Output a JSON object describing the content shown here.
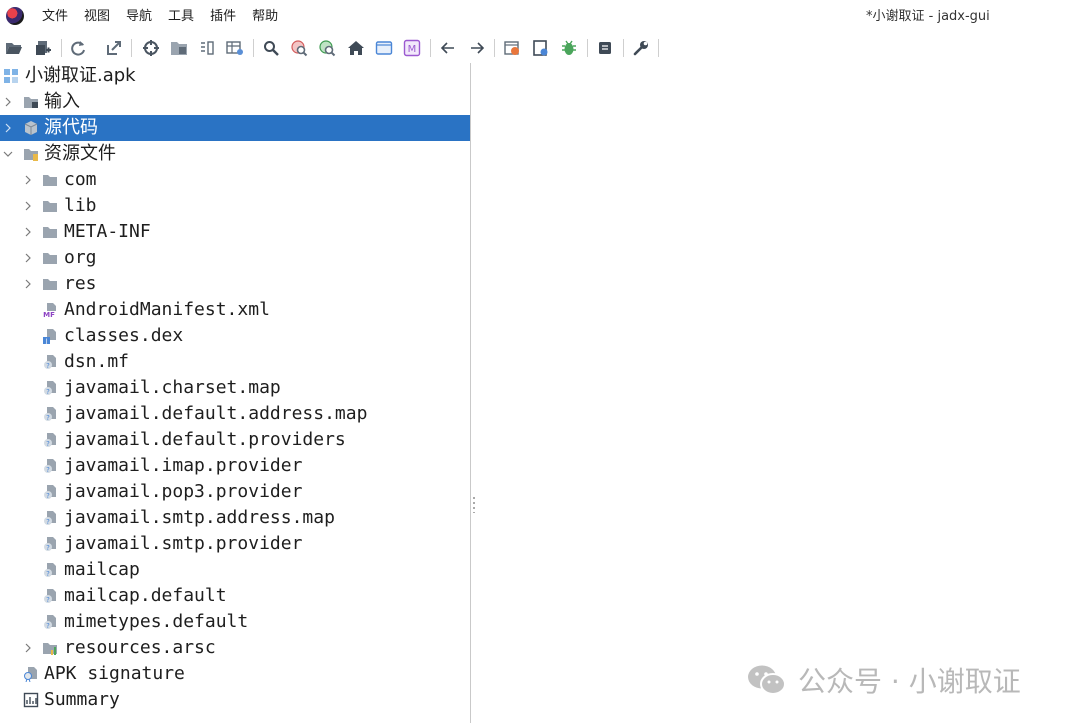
{
  "window": {
    "title": "*小谢取证 - jadx-gui"
  },
  "menu": {
    "items": [
      {
        "label": "文件"
      },
      {
        "label": "视图"
      },
      {
        "label": "导航"
      },
      {
        "label": "工具"
      },
      {
        "label": "插件"
      },
      {
        "label": "帮助"
      }
    ]
  },
  "toolbar": {
    "buttons": [
      "open-file-icon",
      "add-files-icon",
      "reload-icon",
      "export-icon",
      "sync-icon",
      "flatten-packages-icon",
      "split-view-icon",
      "table-icon",
      "search-icon",
      "find-usage-icon",
      "find-class-icon",
      "home-icon",
      "log-icon",
      "smali-icon",
      "back-arrow-icon",
      "forward-arrow-icon",
      "quark-icon",
      "deobfuscation-icon",
      "debug-icon",
      "log-viewer-icon",
      "preferences-icon"
    ]
  },
  "tree": {
    "root": {
      "label": "小谢取证.apk"
    },
    "input": {
      "label": "输入"
    },
    "source_code": {
      "label": "源代码"
    },
    "resources": {
      "label": "资源文件"
    },
    "folders": [
      {
        "label": "com"
      },
      {
        "label": "lib"
      },
      {
        "label": "META-INF"
      },
      {
        "label": "org"
      },
      {
        "label": "res"
      }
    ],
    "files": [
      {
        "label": "AndroidManifest.xml",
        "icon": "manifest-icon"
      },
      {
        "label": "classes.dex",
        "icon": "dex-file-icon"
      },
      {
        "label": "dsn.mf",
        "icon": "unknown-file-icon"
      },
      {
        "label": "javamail.charset.map",
        "icon": "unknown-file-icon"
      },
      {
        "label": "javamail.default.address.map",
        "icon": "unknown-file-icon"
      },
      {
        "label": "javamail.default.providers",
        "icon": "unknown-file-icon"
      },
      {
        "label": "javamail.imap.provider",
        "icon": "unknown-file-icon"
      },
      {
        "label": "javamail.pop3.provider",
        "icon": "unknown-file-icon"
      },
      {
        "label": "javamail.smtp.address.map",
        "icon": "unknown-file-icon"
      },
      {
        "label": "javamail.smtp.provider",
        "icon": "unknown-file-icon"
      },
      {
        "label": "mailcap",
        "icon": "unknown-file-icon"
      },
      {
        "label": "mailcap.default",
        "icon": "unknown-file-icon"
      },
      {
        "label": "mimetypes.default",
        "icon": "unknown-file-icon"
      }
    ],
    "arsc": {
      "label": "resources.arsc"
    },
    "apk_signature": {
      "label": "APK signature"
    },
    "summary": {
      "label": "Summary"
    }
  },
  "watermark": {
    "text": "公众号 · 小谢取证"
  },
  "colors": {
    "selection": "#2a73c4",
    "background": "#ffffff"
  }
}
